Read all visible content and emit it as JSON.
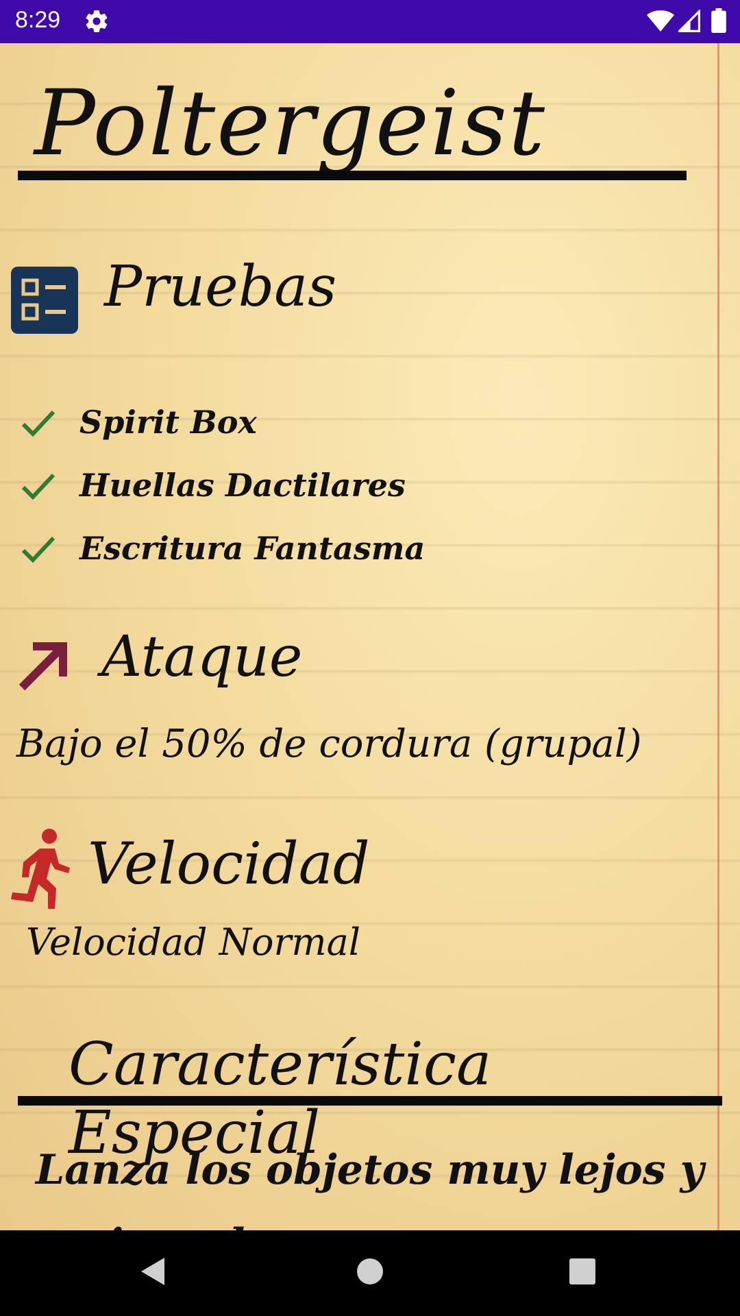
{
  "status_bar": {
    "time": "8:29",
    "icons": [
      "gear-icon",
      "wifi-icon",
      "signal-icon",
      "battery-icon"
    ]
  },
  "ghost": {
    "name": "Poltergeist"
  },
  "evidence_section": {
    "title": "Pruebas",
    "icon": "checklist-icon",
    "items": [
      {
        "label": "Spirit Box",
        "icon": "check-icon"
      },
      {
        "label": "Huellas Dactilares",
        "icon": "check-icon"
      },
      {
        "label": "Escritura Fantasma",
        "icon": "check-icon"
      }
    ]
  },
  "attack_section": {
    "title": "Ataque",
    "icon": "arrow-up-right-icon",
    "text": "Bajo el 50% de cordura (grupal)"
  },
  "speed_section": {
    "title": "Velocidad",
    "icon": "running-person-icon",
    "text": "Velocidad Normal"
  },
  "special_section": {
    "title": "Característica Especial",
    "text": "Lanza los objetos muy lejos y varios a la vez."
  },
  "colors": {
    "status_bar": "#3f0aaa",
    "checklist_icon": "#183558",
    "check_mark": "#2e7d32",
    "arrow": "#7a1f3d",
    "runner": "#c62828",
    "paper": "#f4dc9f"
  },
  "nav_bar": {
    "buttons": [
      "back-icon",
      "home-icon",
      "recents-icon"
    ]
  }
}
